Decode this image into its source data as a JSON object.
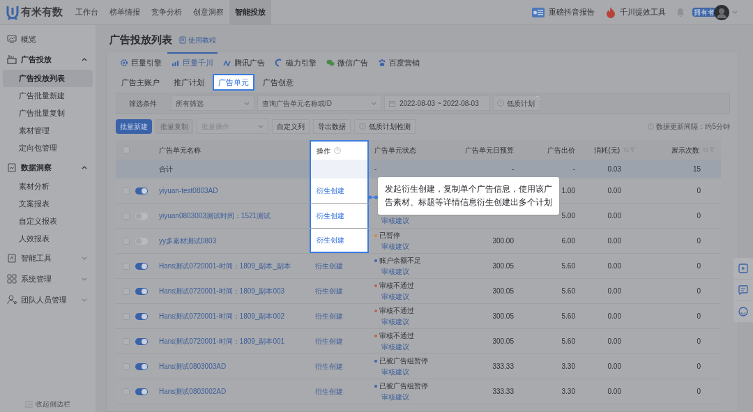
{
  "top_nav": {
    "logo": "有米有数",
    "items": [
      {
        "label": "工作台",
        "selected": false
      },
      {
        "label": "榜单情报",
        "selected": false
      },
      {
        "label": "竞争分析",
        "selected": false
      },
      {
        "label": "创意洞察",
        "selected": false
      },
      {
        "label": "智能投放",
        "selected": true
      }
    ],
    "links": [
      {
        "kind": "report",
        "label": "重磅抖音报告"
      },
      {
        "kind": "fire",
        "label": "千川提效工具"
      }
    ],
    "user_badge": "拥有者"
  },
  "sidebar": {
    "items": [
      {
        "kind": "overview",
        "label": "概览",
        "selected": false
      },
      {
        "kind": "ads",
        "label": "广告投放",
        "expanded": true,
        "children": [
          {
            "label": "广告投放列表",
            "selected": true
          },
          {
            "label": "广告批量新建",
            "selected": false
          },
          {
            "label": "广告批量复制",
            "selected": false
          },
          {
            "label": "素材管理",
            "selected": false
          },
          {
            "label": "定向包管理",
            "selected": false
          }
        ]
      },
      {
        "kind": "data",
        "label": "数据洞察",
        "expanded": true,
        "children": [
          {
            "label": "素材分析",
            "selected": false
          },
          {
            "label": "文案报表",
            "selected": false
          },
          {
            "label": "自定义报表",
            "selected": false
          },
          {
            "label": "人效报表",
            "selected": false
          }
        ]
      },
      {
        "kind": "tools",
        "label": "智能工具",
        "expanded": false
      },
      {
        "kind": "system",
        "label": "系统管理",
        "expanded": false
      },
      {
        "kind": "team",
        "label": "团队人员管理",
        "expanded": false
      }
    ],
    "footer": "收起侧边栏"
  },
  "page": {
    "title": "广告投放列表",
    "help_link": "使用教程"
  },
  "platform_tabs": [
    {
      "kind": "gear",
      "label": "巨量引擎",
      "selected": false
    },
    {
      "kind": "bars",
      "label": "巨量千川",
      "selected": true
    },
    {
      "kind": "wave",
      "label": "腾讯广告",
      "selected": false
    },
    {
      "kind": "ring",
      "label": "磁力引擎",
      "selected": false
    },
    {
      "kind": "chat",
      "label": "微信广告",
      "selected": false
    },
    {
      "kind": "paw",
      "label": "百度营销",
      "selected": false
    }
  ],
  "sub_tabs": [
    {
      "label": "广告主账户",
      "selected": false,
      "highlighted": false
    },
    {
      "label": "推广计划",
      "selected": false,
      "highlighted": false
    },
    {
      "label": "广告单元",
      "selected": true,
      "highlighted": true
    },
    {
      "label": "广告创意",
      "selected": false,
      "highlighted": false
    }
  ],
  "filters": {
    "label": "筛选条件",
    "scope": "所有筛选",
    "search_placeholder": "查询广告单元名称或ID",
    "date_range": "2022-08-03 ~ 2022-08-03",
    "low_quality": "低质计划"
  },
  "toolbar": {
    "buttons": [
      {
        "kind": "primary",
        "label": "批量新建"
      },
      {
        "kind": "disabled",
        "label": "批量复制"
      },
      {
        "kind": "select",
        "label": "批量操作"
      },
      {
        "kind": "default",
        "label": "自定义列"
      },
      {
        "kind": "default",
        "label": "导出数据"
      },
      {
        "kind": "check",
        "label": "低质计划检测"
      }
    ],
    "update_note": "数据更新间隔：约5分钟"
  },
  "table": {
    "columns": [
      {
        "label": "广告单元名称"
      },
      {
        "label": "操作"
      },
      {
        "label": "广告单元状态"
      },
      {
        "label": "广告单元日预算"
      },
      {
        "label": "广告出价"
      },
      {
        "label": "消耗(元)"
      },
      {
        "label": "展示次数"
      }
    ],
    "total": {
      "label": "合计",
      "status": "-",
      "budget": "-",
      "bid": "-",
      "cost": "0.03",
      "impressions": "15"
    },
    "rows": [
      {
        "name": "yiyuan-test0803AD",
        "on": true,
        "action": "衍生创建",
        "highlighted": true,
        "bid": "1.00",
        "cost": "0.00",
        "impressions": "0"
      },
      {
        "name": "yiyuan0803003测试时间：1521测试",
        "on": false,
        "action": "衍生创建",
        "highlighted": true,
        "review_link": "审核建议",
        "bid": "5.00",
        "cost": "0.00",
        "impressions": "0"
      },
      {
        "name": "yy多素材测试0803",
        "on": false,
        "action": "衍生创建",
        "highlighted": true,
        "status": "已暂停",
        "color": "#c98a4a",
        "review_link": "审核建议",
        "budget": "300.00",
        "bid": "6.00",
        "cost": "0.00",
        "impressions": "0"
      },
      {
        "name": "Hans测试0720001-时间：1809_副本_副本",
        "on": true,
        "action": "衍生创建",
        "highlighted": false,
        "status": "账户余额不足",
        "color": "#3a62a8",
        "review_link": "审核建议",
        "budget": "300.05",
        "bid": "5.60",
        "cost": "0.00",
        "impressions": "0"
      },
      {
        "name": "Hans测试0720001-时间：1809_副本003",
        "on": true,
        "action": "衍生创建",
        "highlighted": false,
        "status": "审核不通过",
        "color": "#c0604a",
        "review_link": "审核建议",
        "budget": "300.05",
        "bid": "5.60",
        "cost": "0.00",
        "impressions": "0"
      },
      {
        "name": "Hans测试0720001-时间：1809_副本002",
        "on": true,
        "action": "衍生创建",
        "highlighted": false,
        "status": "审核不通过",
        "color": "#c0604a",
        "review_link": "审核建议",
        "budget": "300.05",
        "bid": "5.60",
        "cost": "0.00",
        "impressions": "0"
      },
      {
        "name": "Hans测试0720001-时间：1809_副本001",
        "on": true,
        "action": "衍生创建",
        "highlighted": false,
        "status": "审核不通过",
        "color": "#c0604a",
        "review_link": "审核建议",
        "budget": "300.05",
        "bid": "5.60",
        "cost": "0.00",
        "impressions": "0"
      },
      {
        "name": "Hans测试0803003AD",
        "on": true,
        "action": "衍生创建",
        "highlighted": false,
        "status": "已被广告组暂停",
        "color": "#3a62a8",
        "review_link": "审核建议",
        "budget": "333.33",
        "bid": "3.30",
        "cost": "0.00",
        "impressions": "0"
      },
      {
        "name": "Hans测试0803002AD",
        "on": true,
        "action": "衍生创建",
        "highlighted": false,
        "status": "已被广告组暂停",
        "color": "#3a62a8",
        "review_link": "审核建议",
        "budget": "333.33",
        "bid": "3.30",
        "cost": "0.00",
        "impressions": "0"
      }
    ]
  },
  "tooltip": "发起衍生创建，复制单个广告信息，使用该广告素材、标题等详情信息衍生创建出多个计划"
}
